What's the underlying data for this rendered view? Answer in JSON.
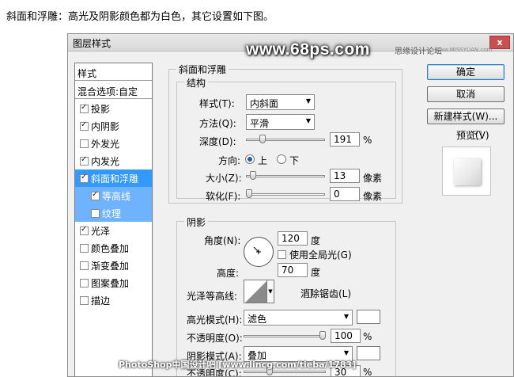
{
  "intro_text": "斜面和浮雕：高光及阴影颜色都为白色，其它设置如下图。",
  "watermarks": {
    "site": "www.68ps.com",
    "forum": "思缘设计论坛",
    "forum_url": "www.MISSYUAN.com",
    "bottom": "PhotoShop中国设计吧 [www.lincg.com/tieba/1783]"
  },
  "dialog": {
    "title": "图层样式",
    "close_label": "x"
  },
  "style_list": {
    "header": "样式",
    "blend_options": "混合选项:自定",
    "items": [
      {
        "label": "投影",
        "checked": true
      },
      {
        "label": "内阴影",
        "checked": true
      },
      {
        "label": "外发光",
        "checked": false
      },
      {
        "label": "内发光",
        "checked": true
      },
      {
        "label": "斜面和浮雕",
        "checked": true
      },
      {
        "label": "等高线",
        "checked": true
      },
      {
        "label": "纹理",
        "checked": false
      },
      {
        "label": "光泽",
        "checked": true
      },
      {
        "label": "颜色叠加",
        "checked": false
      },
      {
        "label": "渐变叠加",
        "checked": false
      },
      {
        "label": "图案叠加",
        "checked": false
      },
      {
        "label": "描边",
        "checked": false
      }
    ]
  },
  "bevel": {
    "group_title": "斜面和浮雕",
    "structure_title": "结构",
    "style_label": "样式(T):",
    "style_value": "内斜面",
    "technique_label": "方法(Q):",
    "technique_value": "平滑",
    "depth_label": "深度(D):",
    "depth_value": "191",
    "depth_unit": "%",
    "depth_fraction": 0.19,
    "direction_label": "方向:",
    "direction_up": "上",
    "direction_down": "下",
    "size_label": "大小(Z):",
    "size_value": "13",
    "size_unit": "像素",
    "size_fraction": 0.05,
    "soften_label": "软化(F):",
    "soften_value": "0",
    "soften_unit": "像素",
    "soften_fraction": 0.0
  },
  "shading": {
    "title": "阴影",
    "angle_label": "角度(N):",
    "angle_value": "120",
    "angle_unit": "度",
    "global_light_label": "使用全局光(G)",
    "global_light_checked": false,
    "altitude_label": "高度:",
    "altitude_value": "70",
    "altitude_unit": "度",
    "gloss_contour_label": "光泽等高线:",
    "anti_alias_label": "消除锯齿(L)",
    "anti_alias_checked": false,
    "highlight_mode_label": "高光模式(H):",
    "highlight_mode_value": "滤色",
    "highlight_color": "#ffffff",
    "highlight_opacity_label": "不透明度(O):",
    "highlight_opacity_value": "100",
    "highlight_opacity_unit": "%",
    "highlight_opacity_fraction": 1.0,
    "shadow_mode_label": "阴影模式(A):",
    "shadow_mode_value": "叠加",
    "shadow_color": "#ffffff",
    "shadow_opacity_label": "不透明度(C):",
    "shadow_opacity_value": "30",
    "shadow_opacity_unit": "%",
    "shadow_opacity_fraction": 0.3
  },
  "buttons": {
    "ok": "确定",
    "cancel": "取消",
    "new_style": "新建样式(W)...",
    "preview_label": "预览(V)",
    "preview_checked": true
  },
  "icons": {
    "dropdown": "chevron-down-icon",
    "close": "close-icon",
    "angle_dial": "angle-dial-icon",
    "contour": "contour-curve-icon"
  }
}
